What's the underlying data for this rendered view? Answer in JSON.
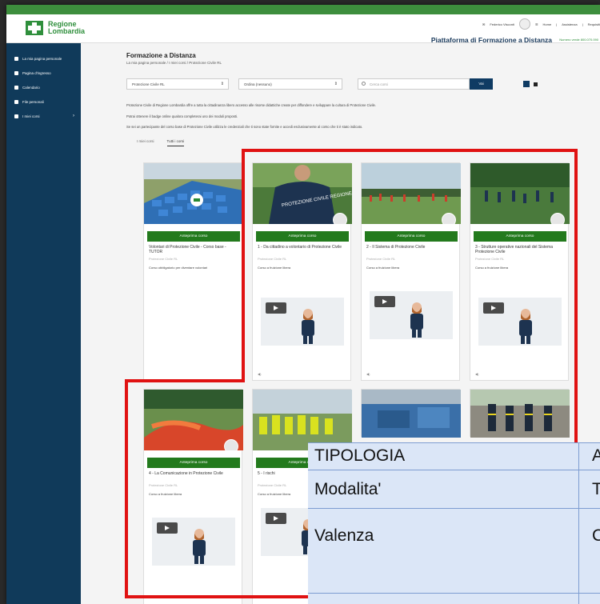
{
  "header": {
    "logo_line1": "Regione",
    "logo_line2": "Lombardia",
    "user": "Federico Visconti",
    "nav_home": "Home",
    "nav_help": "Assistenza",
    "nav_requisiti": "Requisiti",
    "platform_title": "Piattaforma di Formazione a Distanza",
    "helpline": "Numero verde 800.070.090"
  },
  "sidebar": {
    "items": [
      {
        "label": "La mia pagina personale",
        "icon": "dashboard-icon"
      },
      {
        "label": "Pagina d'ingresso",
        "icon": "home-icon"
      },
      {
        "label": "Calendario",
        "icon": "calendar-icon"
      },
      {
        "label": "File personali",
        "icon": "file-icon"
      },
      {
        "label": "I miei corsi",
        "icon": "graduation-cap-icon"
      }
    ]
  },
  "main": {
    "title": "Formazione a Distanza",
    "breadcrumb": "La mia pagina personale / I miei corsi / Protezione Civile RL",
    "filter_category": "Protezione Civile RL",
    "filter_sort": "Ordina (nessuno)",
    "search_placeholder": "Cerca corsi",
    "search_button": "Vai",
    "intro_1": "Protezione Civile di Regione Lombardia offre a tutta la cittadinanza libero accesso alle risorse didattiche create per diffondere e sviluppare la cultura di Protezione Civile.",
    "intro_2": "Potrai ottenere il badge online qualora completerai uno dei moduli proposti.",
    "intro_3": "Se sei un partecipante del corso base di Protezione Civile utilizza le credenziali che ti sono state fornite e accedi esclusivamente al corso che ti è stato indicato.",
    "tab_1": "I miei corsi",
    "tab_2": "Tutti i corsi"
  },
  "cards": [
    {
      "button": "Anteprima corso",
      "title": "Volontari di Protezione Civile - Corso base - TUTOR",
      "category": "Protezione Civile RL",
      "note": "Corso obbligatorio per diventare volontari"
    },
    {
      "button": "Anteprima corso",
      "title": "1 - Da cittadino a volontario di Protezione Civile",
      "category": "Protezione Civile RL",
      "note": "Corso a fruizione libera"
    },
    {
      "button": "Anteprima corso",
      "title": "2 - Il Sistema di Protezione Civile",
      "category": "Protezione Civile RL",
      "note": "Corso a fruizione libera"
    },
    {
      "button": "Anteprima corso",
      "title": "3 - Strutture operative nazionali del Sistema Protezione Civile",
      "category": "Protezione Civile RL",
      "note": "Corso a fruizione libera"
    },
    {
      "button": "Anteprima corso",
      "title": "4 - La Comunicazione in Protezione Civile",
      "category": "Protezione Civile RL",
      "note": "Corso a fruizione libera"
    },
    {
      "button": "Anteprima corso",
      "title": "5 - I rischi",
      "category": "Protezione Civile RL",
      "note": "Corso a fruizione libera"
    }
  ],
  "vest_text": "PROTEZIONE CIVILE REGIONE LOMBARDIA",
  "overlay": {
    "rows": [
      {
        "label": "TIPOLOGIA",
        "value": "A"
      },
      {
        "label": "Modalita'",
        "value": "T"
      },
      {
        "label": "Valenza",
        "value": "C"
      }
    ]
  },
  "colors": {
    "sidebar": "#103a5a",
    "accent_green": "#237a1d",
    "highlight": "#e01212",
    "overlay_bg": "#dbe6f7"
  }
}
